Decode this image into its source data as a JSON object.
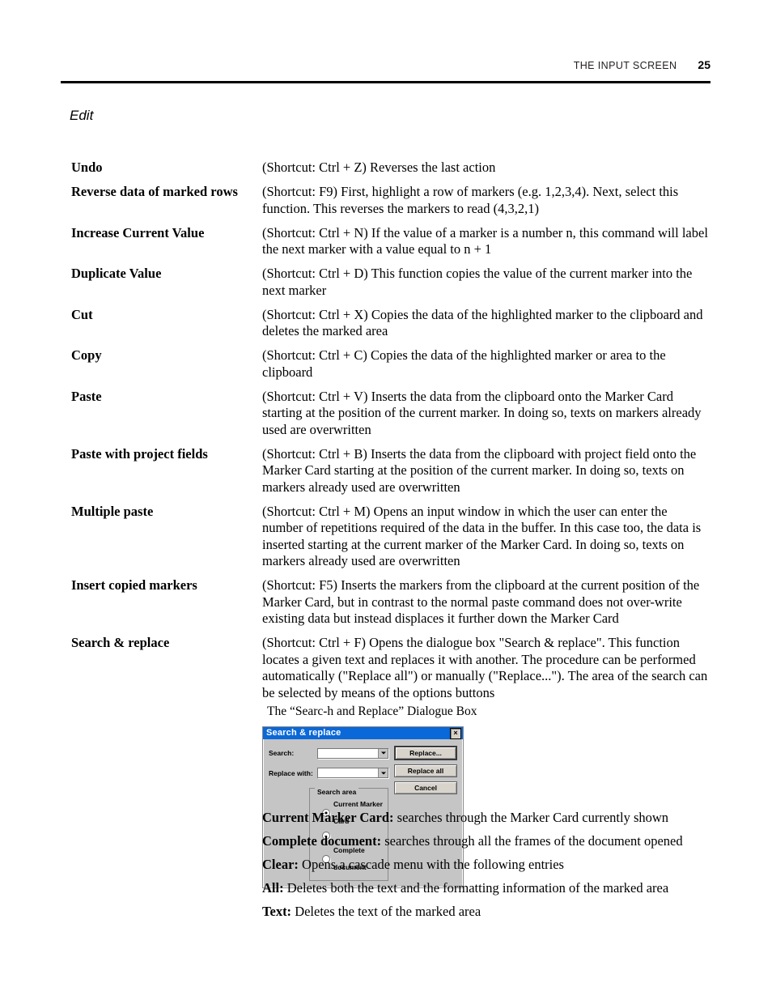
{
  "header": {
    "title": "THE INPUT SCREEN",
    "page_number": "25"
  },
  "section": {
    "title": "Edit"
  },
  "entries": [
    {
      "term": "Undo",
      "description": "(Shortcut: Ctrl + Z) Reverses the last action"
    },
    {
      "term": "Reverse data of marked rows",
      "description": "(Shortcut: F9) First, highlight a row of markers (e.g. 1,2,3,4). Next, select this function. This reverses the markers to read (4,3,2,1)"
    },
    {
      "term": "Increase Current Value",
      "description": "(Shortcut: Ctrl + N) If the value of a marker is a number n, this command will label the next marker with a value equal to n + 1"
    },
    {
      "term": "Duplicate Value",
      "description": "(Shortcut: Ctrl + D) This function copies the value of the current marker into the next marker"
    },
    {
      "term": "Cut",
      "description": "(Shortcut: Ctrl + X) Copies the data of the highlighted marker to the clipboard and deletes the marked area"
    },
    {
      "term": "Copy",
      "description": "(Shortcut: Ctrl + C) Copies the data of the highlighted marker or area to the clipboard"
    },
    {
      "term": "Paste",
      "description": "(Shortcut: Ctrl + V) Inserts the data from the clipboard onto the Marker Card starting at the position of the current marker. In doing so, texts on markers already used are overwritten"
    },
    {
      "term": "Paste with project fields",
      "description": "(Shortcut: Ctrl + B) Inserts the data from the clipboard with project field onto the Marker Card starting at the position of the current marker. In doing so, texts on markers already used are overwritten"
    },
    {
      "term": "Multiple paste",
      "description": "(Shortcut: Ctrl + M) Opens an input window in which the user can enter the number of repetitions required of the data in the buffer. In this case too, the data is inserted starting at the current marker of the Marker Card. In doing so, texts on markers already used are overwritten"
    },
    {
      "term": "Insert copied markers",
      "description": "(Shortcut: F5) Inserts the markers from the clipboard at the current position of the Marker Card, but in contrast to the normal paste command does not over-write existing data but instead displaces it further down the Marker Card"
    },
    {
      "term": "Search & replace",
      "description": "(Shortcut: Ctrl + F) Opens the dialogue box \"Search & replace\". This function locates a given text and replaces it with another. The procedure can be performed automatically (\"Replace all\") or manually (\"Replace...\"). The area of the search can be selected by means of the options buttons"
    }
  ],
  "figure": {
    "caption": "The “Searc-h and Replace” Dialogue Box",
    "dialog": {
      "title": "Search & replace",
      "close_label": "×",
      "fields": [
        {
          "label": "Search:",
          "value": ""
        },
        {
          "label": "Replace with:",
          "value": ""
        }
      ],
      "groupbox_legend": "Search area",
      "radios": [
        {
          "label": "Current Marker Card",
          "checked": true
        },
        {
          "label": "",
          "checked": false
        },
        {
          "label": "Complete document",
          "checked": false
        }
      ],
      "buttons": [
        {
          "label": "Replace...",
          "default": true
        },
        {
          "label": "Replace all",
          "default": false
        },
        {
          "label": "Cancel",
          "default": false
        }
      ]
    }
  },
  "glossary": [
    {
      "term": "Current Marker Card:",
      "text": " searches through the Marker Card currently shown"
    },
    {
      "term": "Complete document:",
      "text": " searches through all the frames of the document opened"
    },
    {
      "term": "Clear:",
      "text": " Opens a cascade menu with the following entries"
    },
    {
      "term": "All:",
      "text": " Deletes both the text and the formatting information of the marked area"
    },
    {
      "term": "Text:",
      "text": " Deletes the text of the marked area"
    }
  ],
  "colors": {
    "titlebar": "#0a68d8",
    "dialog_face": "#c5c5c5",
    "rule": "#000000"
  }
}
